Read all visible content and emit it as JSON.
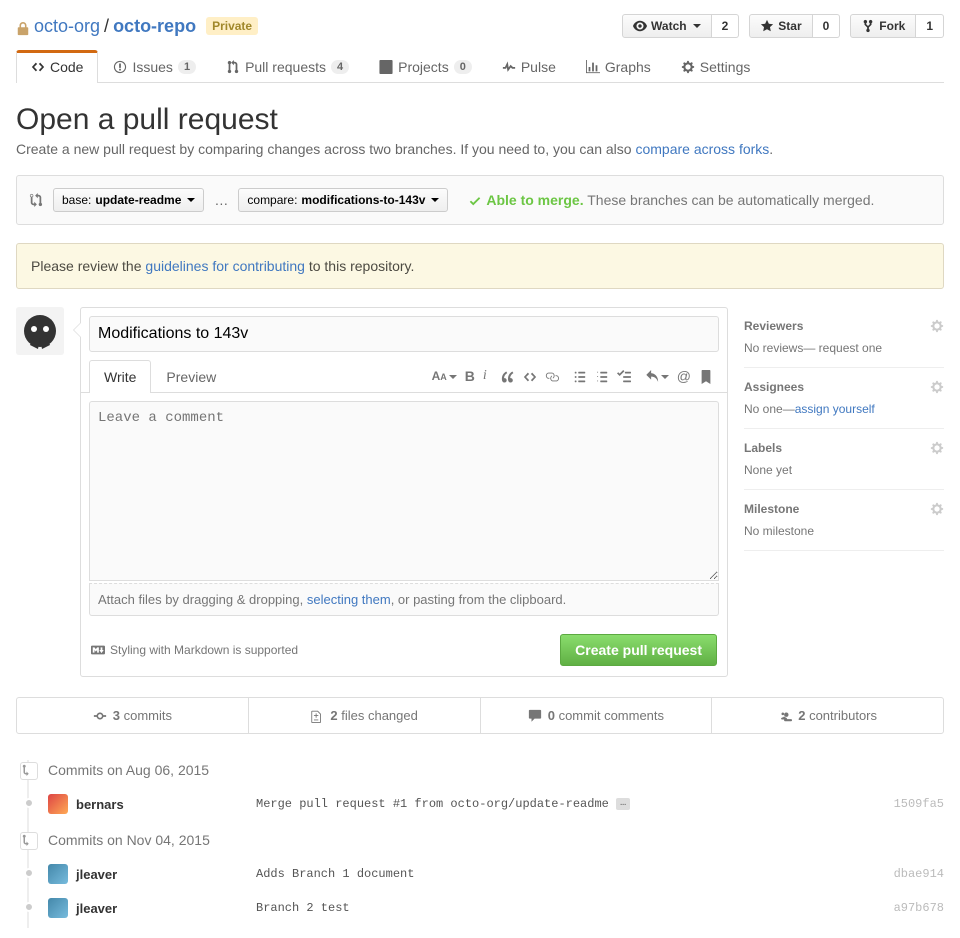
{
  "repo": {
    "org": "octo-org",
    "name": "octo-repo",
    "visibility": "Private"
  },
  "actions": {
    "watch": {
      "label": "Watch",
      "count": "2"
    },
    "star": {
      "label": "Star",
      "count": "0"
    },
    "fork": {
      "label": "Fork",
      "count": "1"
    }
  },
  "nav": {
    "code": "Code",
    "issues": {
      "label": "Issues",
      "count": "1"
    },
    "pulls": {
      "label": "Pull requests",
      "count": "4"
    },
    "projects": {
      "label": "Projects",
      "count": "0"
    },
    "pulse": "Pulse",
    "graphs": "Graphs",
    "settings": "Settings"
  },
  "page": {
    "title": "Open a pull request",
    "desc_prefix": "Create a new pull request by comparing changes across two branches. If you need to, you can also ",
    "desc_link": "compare across forks",
    "desc_suffix": "."
  },
  "compare": {
    "base_label": "base:",
    "base_branch": "update-readme",
    "compare_label": "compare:",
    "compare_branch": "modifications-to-143v",
    "merge_ok": "Able to merge.",
    "merge_text": "These branches can be automatically merged."
  },
  "flash": {
    "prefix": "Please review the ",
    "link": "guidelines for contributing",
    "suffix": " to this repository."
  },
  "form": {
    "title_value": "Modifications to 143v",
    "tab_write": "Write",
    "tab_preview": "Preview",
    "placeholder": "Leave a comment",
    "attach_prefix": "Attach files by dragging & dropping, ",
    "attach_link": "selecting them",
    "attach_suffix": ", or pasting from the clipboard.",
    "markdown_hint": "Styling with Markdown is supported",
    "submit": "Create pull request"
  },
  "sidebar": {
    "reviewers": {
      "title": "Reviewers",
      "text": "No reviews— request one"
    },
    "assignees": {
      "title": "Assignees",
      "text_prefix": "No one—",
      "text_link": "assign yourself"
    },
    "labels": {
      "title": "Labels",
      "text": "None yet"
    },
    "milestone": {
      "title": "Milestone",
      "text": "No milestone"
    }
  },
  "stats": {
    "commits": {
      "num": "3",
      "label": " commits"
    },
    "files": {
      "num": "2",
      "label": " files changed"
    },
    "comments": {
      "num": "0",
      "label": " commit comments"
    },
    "contributors": {
      "num": "2",
      "label": " contributors"
    }
  },
  "commits": {
    "group1": {
      "title": "Commits on Aug 06, 2015",
      "items": [
        {
          "author": "bernars",
          "msg": "Merge pull request #1 from octo-org/update-readme",
          "sha": "1509fa5"
        }
      ]
    },
    "group2": {
      "title": "Commits on Nov 04, 2015",
      "items": [
        {
          "author": "jleaver",
          "msg": "Adds Branch 1 document",
          "sha": "dbae914"
        },
        {
          "author": "jleaver",
          "msg": "Branch 2 test",
          "sha": "a97b678"
        }
      ]
    }
  }
}
